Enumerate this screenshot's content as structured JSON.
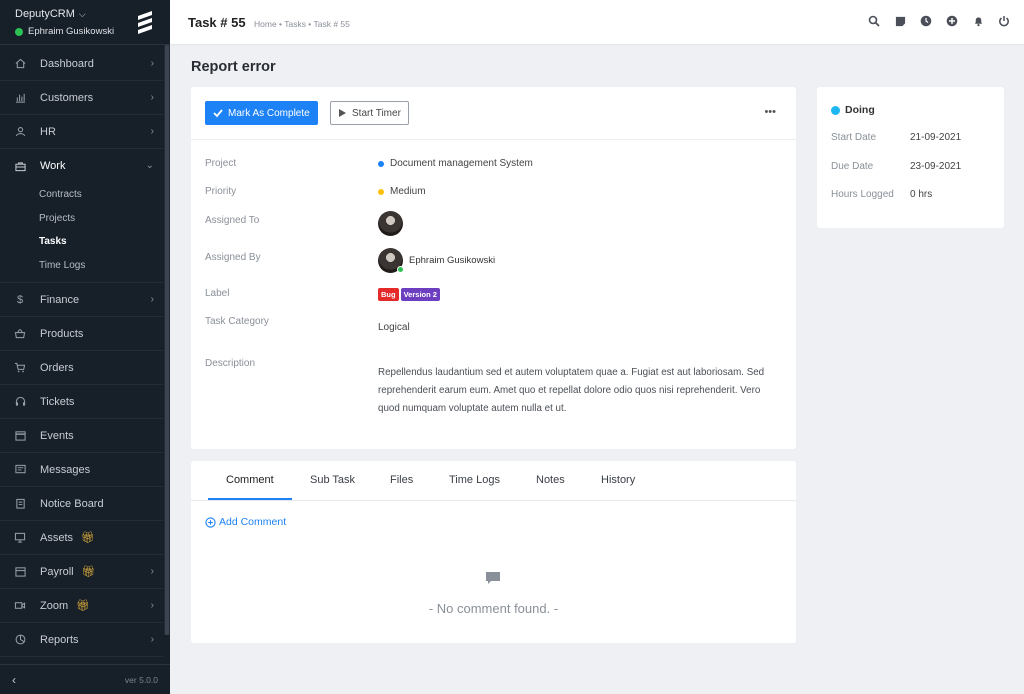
{
  "sidebar": {
    "brand": "DeputyCRM",
    "user": "Ephraim Gusikowski",
    "items": [
      {
        "label": "Dashboard"
      },
      {
        "label": "Customers"
      },
      {
        "label": "HR"
      },
      {
        "label": "Work"
      },
      {
        "label": "Finance"
      },
      {
        "label": "Products"
      },
      {
        "label": "Orders"
      },
      {
        "label": "Tickets"
      },
      {
        "label": "Events"
      },
      {
        "label": "Messages"
      },
      {
        "label": "Notice Board"
      },
      {
        "label": "Assets"
      },
      {
        "label": "Payroll"
      },
      {
        "label": "Zoom"
      },
      {
        "label": "Reports"
      }
    ],
    "work_sub": [
      "Contracts",
      "Projects",
      "Tasks",
      "Time Logs"
    ],
    "active_sub": "Tasks",
    "version": "ver 5.0.0"
  },
  "topbar": {
    "title": "Task # 55",
    "breadcrumb": "Home • Tasks • Task # 55"
  },
  "task": {
    "heading": "Report error",
    "complete_btn": "Mark As Complete",
    "timer_btn": "Start Timer",
    "more": "•••",
    "labels": {
      "project": "Project",
      "priority": "Priority",
      "assigned_to": "Assigned To",
      "assigned_by": "Assigned By",
      "label": "Label",
      "category": "Task Category",
      "description": "Description"
    },
    "project": "Document management System",
    "project_color": "#1d82f5",
    "priority": "Medium",
    "priority_color": "#ffc107",
    "assigned_by_name": "Ephraim Gusikowski",
    "tags": [
      {
        "text": "Bug",
        "color": "#e52a2a"
      },
      {
        "text": "Version 2",
        "color": "#6c3fc1"
      }
    ],
    "category": "Logical",
    "description": "Repellendus laudantium sed et autem voluptatem quae a. Fugiat est aut laboriosam. Sed reprehenderit earum eum. Amet quo et repellat dolore odio quos nisi reprehenderit. Vero quod numquam voluptate autem nulla et ut."
  },
  "tabs": [
    "Comment",
    "Sub Task",
    "Files",
    "Time Logs",
    "Notes",
    "History"
  ],
  "comments": {
    "add": "Add Comment",
    "empty": "- No comment found. -"
  },
  "side": {
    "status": "Doing",
    "status_color": "#1db7f2",
    "start_label": "Start Date",
    "start": "21-09-2021",
    "due_label": "Due Date",
    "due": "23-09-2021",
    "hours_label": "Hours Logged",
    "hours": "0 hrs"
  },
  "icons": {
    "top": [
      "search-icon",
      "sticky-note-icon",
      "clock-icon",
      "plus-circle-icon",
      "bell-icon",
      "power-icon"
    ]
  }
}
